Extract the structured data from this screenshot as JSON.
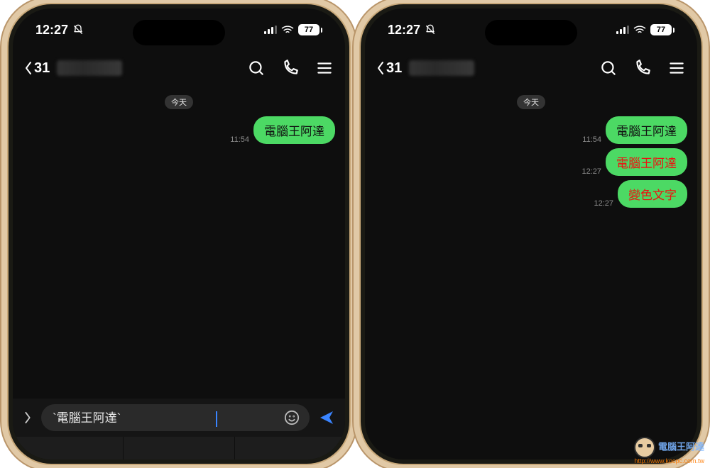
{
  "status": {
    "time": "12:27",
    "battery": "77"
  },
  "nav": {
    "back_count": "31"
  },
  "chat": {
    "day_label": "今天"
  },
  "left": {
    "messages": [
      {
        "time": "11:54",
        "text": "電腦王阿達",
        "red": false
      }
    ],
    "compose_value": "`電腦王阿達`"
  },
  "right": {
    "messages": [
      {
        "time": "11:54",
        "text": "電腦王阿達",
        "red": false
      },
      {
        "time": "12:27",
        "text": "電腦王阿達",
        "red": true
      },
      {
        "time": "12:27",
        "text": "變色文字",
        "red": true
      }
    ]
  },
  "watermark": {
    "brand": "電腦王阿達",
    "url": "http://www.kocpc.com.tw"
  }
}
